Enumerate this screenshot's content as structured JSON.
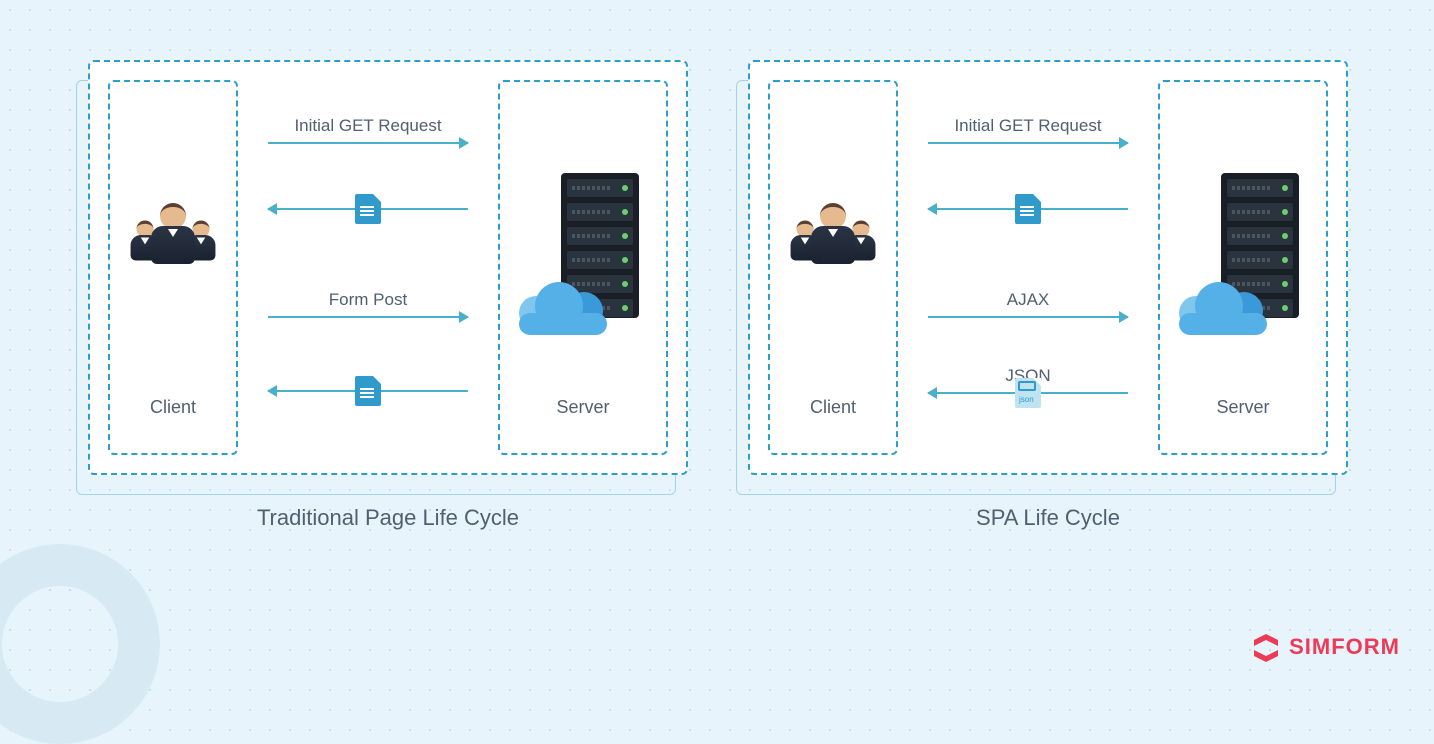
{
  "panels": {
    "traditional": {
      "caption": "Traditional Page Life Cycle",
      "client_label": "Client",
      "server_label": "Server",
      "flows": {
        "r1_label": "Initial GET Request",
        "r3_label": "Form Post"
      }
    },
    "spa": {
      "caption": "SPA Life Cycle",
      "client_label": "Client",
      "server_label": "Server",
      "flows": {
        "r1_label": "Initial GET Request",
        "r3_label": "AJAX",
        "r4_label": "JSON"
      }
    }
  },
  "brand": {
    "name": "SIMFORM"
  },
  "colors": {
    "background": "#e8f4fb",
    "dashed_border": "#2a9fc9",
    "arrow": "#49b0c9",
    "brand": "#ec3a57",
    "text": "#506070"
  }
}
